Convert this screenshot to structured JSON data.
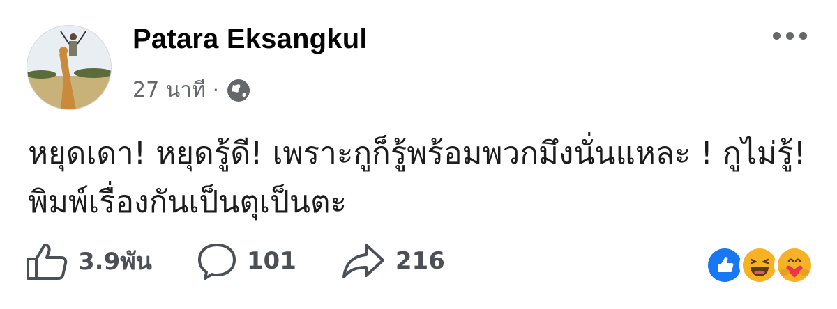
{
  "post": {
    "author": "Patara Eksangkul",
    "time": "27 นาที",
    "separator": "·",
    "privacy_icon": "globe-icon",
    "text": "หยุดเดา! หยุดรู้ดี! เพราะกูก็รู้พร้อมพวกมึงนั่นแหละ ! กูไม่รู้! พิมพ์เรื่องกันเป็นตุเป็นตะ"
  },
  "actions": {
    "like_count": "3.9พัน",
    "comment_count": "101",
    "share_count": "216"
  },
  "reactions": [
    "like-reaction-icon",
    "haha-reaction-icon",
    "care-reaction-icon"
  ],
  "colors": {
    "text": "#050505",
    "secondary": "#65676b",
    "like_blue": "#1877f2",
    "emoji_yellow": "#f7b125"
  }
}
